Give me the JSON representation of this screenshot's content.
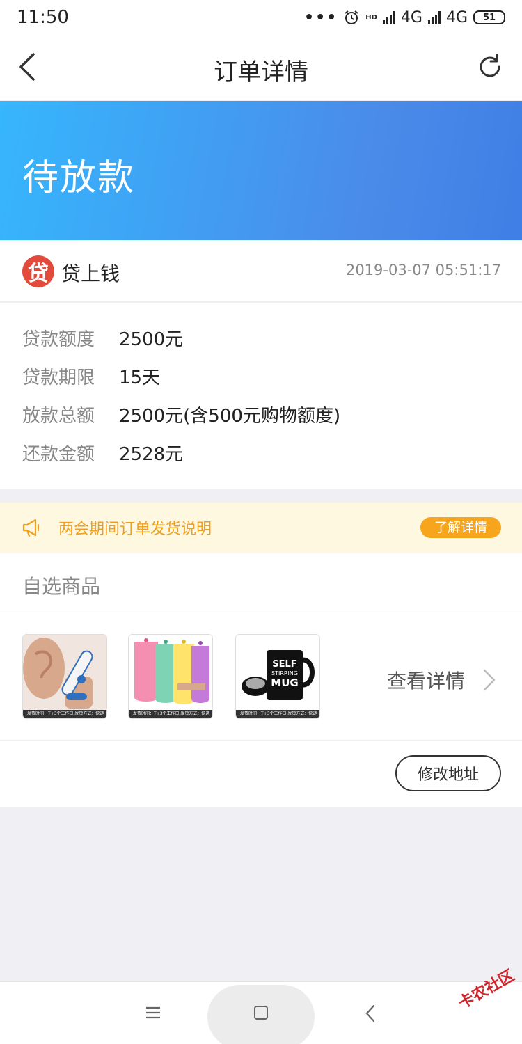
{
  "status_bar": {
    "time": "11:50",
    "signal_hd": "HD",
    "network_1": "4G",
    "network_2": "4G",
    "battery": "51"
  },
  "nav": {
    "title": "订单详情",
    "back_icon": "chevron-left-icon",
    "refresh_icon": "refresh-icon"
  },
  "banner": {
    "status": "待放款"
  },
  "lender": {
    "logo_char": "贷",
    "name": "贷上钱",
    "time": "2019-03-07 05:51:17"
  },
  "details": [
    {
      "label": "贷款额度",
      "value": "2500元"
    },
    {
      "label": "贷款期限",
      "value": "15天"
    },
    {
      "label": "放款总额",
      "value": "2500元(含500元购物额度)"
    },
    {
      "label": "还款金额",
      "value": "2528元"
    }
  ],
  "notice": {
    "text": "两会期间订单发货说明",
    "button": "了解详情"
  },
  "goods": {
    "title": "自选商品",
    "products": [
      {
        "caption": "发货时间：T+3个工作日 发货方式：快递"
      },
      {
        "caption": "发货时间：T+3个工作日 发货方式：快递"
      },
      {
        "caption": "发货时间：T+3个工作日 发货方式：快递",
        "mug_text": [
          "SELF",
          "STIRRING",
          "MUG"
        ]
      }
    ],
    "view_details": "查看详情",
    "modify_address": "修改地址"
  },
  "watermark": "卡农社区",
  "colors": {
    "banner_start": "#36b6fd",
    "banner_end": "#3f7fe6",
    "accent_orange": "#f7a51c",
    "notice_bg": "#fff8e0"
  }
}
